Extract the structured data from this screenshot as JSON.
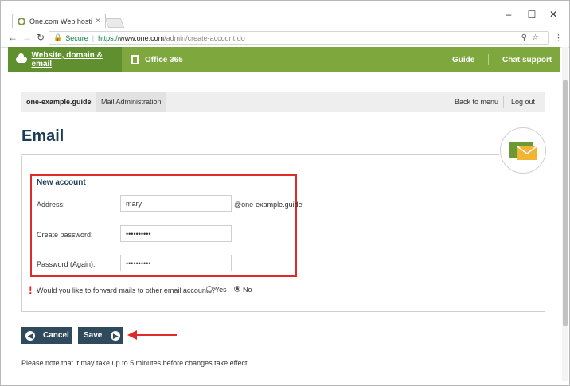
{
  "browser": {
    "tab_title": "One.com Web hosting",
    "tab_close": "×",
    "secure_label": "Secure",
    "url_https": "https://",
    "url_host": "www.one.com",
    "url_path": "/admin/create-account.do",
    "window_controls": [
      "–",
      "☐",
      "✕"
    ]
  },
  "site_nav": {
    "website_label": "Website, domain & email",
    "office_label": "Office 365",
    "guide_label": "Guide",
    "chat_label": "Chat support"
  },
  "sub_header": {
    "domain": "one-example.guide",
    "mail_admin": "Mail Administration",
    "back_to_menu": "Back to menu",
    "log_out": "Log out"
  },
  "page": {
    "title": "Email"
  },
  "form": {
    "section_title": "New account",
    "address_label": "Address:",
    "address_value": "mary",
    "address_suffix": "@one-example.guide",
    "password_label": "Create password:",
    "password_value": "••••••••••",
    "password_again_label": "Password (Again):",
    "password_again_value": "••••••••••",
    "forward_question": "Would you like to forward mails to other email accounts?",
    "forward_yes": "Yes",
    "forward_no": "No",
    "forward_selected": "No"
  },
  "actions": {
    "cancel_label": "Cancel",
    "save_label": "Save"
  },
  "footer": {
    "note": "Please note that it may take up to 5 minutes before changes take effect."
  },
  "colors": {
    "nav_green": "#7ea83e",
    "nav_active_green": "#5f8f2e",
    "button_navy": "#2f4a5c",
    "highlight_red": "#e02a2a",
    "title_navy": "#1c3d57"
  }
}
